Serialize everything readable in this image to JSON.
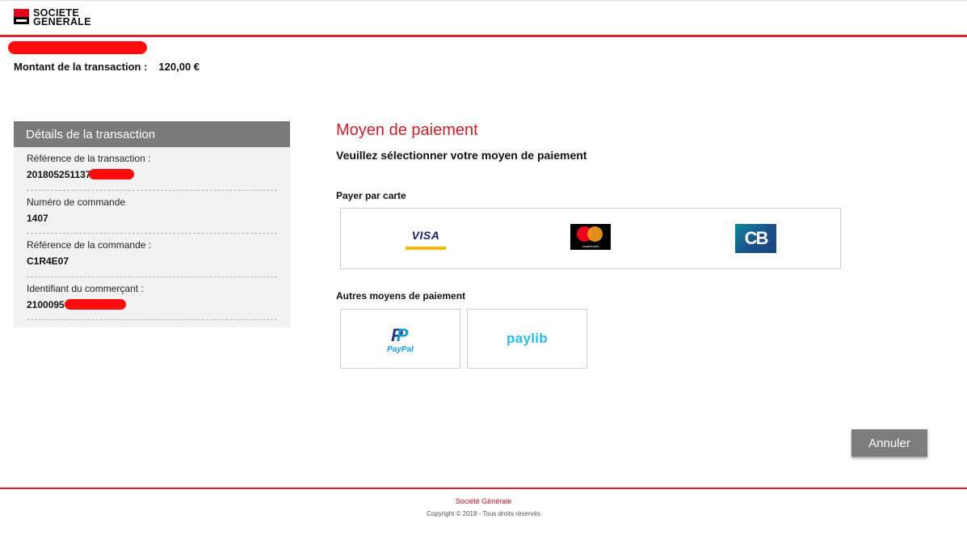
{
  "brand": {
    "name_line1": "SOCIETE",
    "name_line2": "GENERALE"
  },
  "transaction": {
    "amount_label": "Montant de la transaction :",
    "amount_value": "120,00 €"
  },
  "details": {
    "title": "Détails de la transaction",
    "rows": [
      {
        "label": "Référence de la transaction :",
        "value": "201805251137"
      },
      {
        "label": "Numéro de commande",
        "value": "1407"
      },
      {
        "label": "Référence de la commande :",
        "value": "C1R4E07"
      },
      {
        "label": "Identifiant du commerçant :",
        "value": "2100095"
      }
    ]
  },
  "payment": {
    "title": "Moyen de paiement",
    "subtitle": "Veuillez sélectionner votre moyen de paiement",
    "cards_label": "Payer par carte",
    "cards": {
      "visa": "VISA",
      "mastercard": "mastercard",
      "cb": "CB"
    },
    "others_label": "Autres moyens de paiement",
    "others": {
      "paypal": "PayPal",
      "paylib": "paylib"
    }
  },
  "actions": {
    "cancel_label": "Annuler"
  },
  "footer": {
    "name": "Société Générale",
    "copyright": "Copyright © 2018 - Tous droits réservés"
  },
  "colors": {
    "brand_red": "#d5262b",
    "title_red": "#c8202a",
    "header_gray": "#7a7a7a",
    "panel_bg": "#f2f2f2"
  },
  "icons": [
    "societe-generale-logo",
    "visa-logo",
    "mastercard-logo",
    "cb-logo",
    "paypal-logo",
    "paylib-logo"
  ]
}
